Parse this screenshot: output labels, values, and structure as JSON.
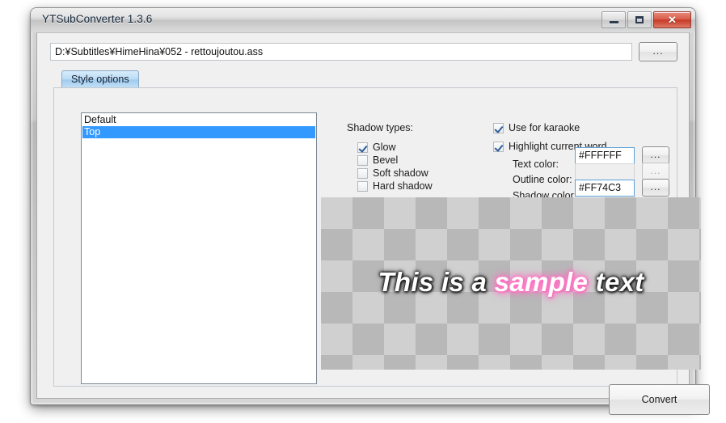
{
  "window": {
    "title": "YTSubConverter 1.3.6",
    "controls": {
      "minimize": "minimize-button",
      "maximize": "maximize-button",
      "close": "✕"
    }
  },
  "file": {
    "path": "D:¥Subtitles¥HimeHina¥052 - rettoujoutou.ass",
    "browse_label": "..."
  },
  "tabs": [
    {
      "label": "Style options",
      "selected": true
    }
  ],
  "style_list": {
    "items": [
      {
        "label": "Default",
        "selected": false
      },
      {
        "label": "Top",
        "selected": true
      }
    ]
  },
  "shadow_types": {
    "heading": "Shadow types:",
    "options": [
      {
        "label": "Glow",
        "checked": true
      },
      {
        "label": "Bevel",
        "checked": false
      },
      {
        "label": "Soft shadow",
        "checked": false
      },
      {
        "label": "Hard shadow",
        "checked": false
      }
    ]
  },
  "karaoke": {
    "use_for_karaoke": {
      "label": "Use for karaoke",
      "checked": true
    },
    "highlight_current_word": {
      "label": "Highlight current word",
      "checked": true
    },
    "colors": [
      {
        "label": "Text color:",
        "value": "#FFFFFF",
        "enabled": true,
        "focused": false,
        "button": "..."
      },
      {
        "label": "Outline color:",
        "value": "",
        "enabled": false,
        "focused": false,
        "button": "..."
      },
      {
        "label": "Shadow color:",
        "value": "#FF74C3",
        "enabled": true,
        "focused": true,
        "button": "..."
      }
    ]
  },
  "preview": {
    "text_before": "This is a ",
    "text_highlight": "sample",
    "text_after": " text",
    "highlight_color": "#FF74C3",
    "text_color": "#FFFFFF"
  },
  "actions": {
    "convert_label": "Convert"
  }
}
